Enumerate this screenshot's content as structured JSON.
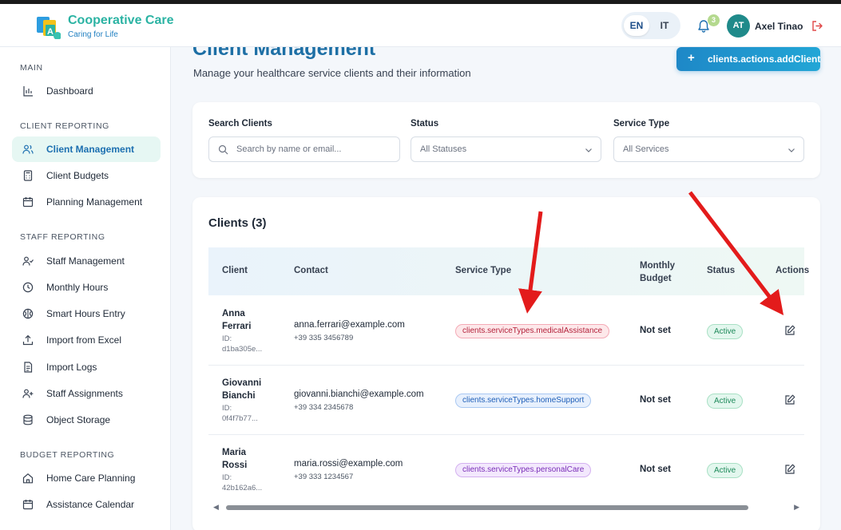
{
  "app": {
    "title": "Cooperative Care",
    "subtitle": "Caring for Life"
  },
  "header": {
    "lang_en": "EN",
    "lang_it": "IT",
    "notification_count": "3",
    "avatar_initials": "AT",
    "user_name": "Axel Tinao"
  },
  "sidebar": {
    "sections": [
      {
        "label": "MAIN",
        "items": [
          {
            "label": "Dashboard",
            "icon": "bar-chart-icon"
          }
        ]
      },
      {
        "label": "CLIENT REPORTING",
        "items": [
          {
            "label": "Client Management",
            "icon": "users-icon",
            "active": true
          },
          {
            "label": "Client Budgets",
            "icon": "calculator-icon"
          },
          {
            "label": "Planning Management",
            "icon": "calendar-icon"
          }
        ]
      },
      {
        "label": "STAFF REPORTING",
        "items": [
          {
            "label": "Staff Management",
            "icon": "user-check-icon"
          },
          {
            "label": "Monthly Hours",
            "icon": "clock-icon"
          },
          {
            "label": "Smart Hours Entry",
            "icon": "brain-icon"
          },
          {
            "label": "Import from Excel",
            "icon": "upload-icon"
          },
          {
            "label": "Import Logs",
            "icon": "file-text-icon"
          },
          {
            "label": "Staff Assignments",
            "icon": "user-plus-icon"
          },
          {
            "label": "Object Storage",
            "icon": "database-icon"
          }
        ]
      },
      {
        "label": "BUDGET REPORTING",
        "items": [
          {
            "label": "Home Care Planning",
            "icon": "home-icon"
          },
          {
            "label": "Assistance Calendar",
            "icon": "calendar-icon"
          }
        ]
      }
    ]
  },
  "main": {
    "page_title": "Client Management",
    "page_subtitle": "Manage your healthcare service clients and their information",
    "add_button": "clients.actions.addClient",
    "filters": {
      "search_label": "Search Clients",
      "search_placeholder": "Search by name or email...",
      "status_label": "Status",
      "status_value": "All Statuses",
      "service_label": "Service Type",
      "service_value": "All Services"
    },
    "table": {
      "title": "Clients (3)",
      "columns": [
        "Client",
        "Contact",
        "Service Type",
        "Monthly Budget",
        "Status",
        "Actions"
      ],
      "rows": [
        {
          "first": "Anna",
          "last": "Ferrari",
          "id_label": "ID:",
          "id": "d1ba305e...",
          "email": "anna.ferrari@example.com",
          "phone": "+39 335 3456789",
          "service": "clients.serviceTypes.medicalAssistance",
          "budget": "Not set",
          "status": "Active"
        },
        {
          "first": "Giovanni",
          "last": "Bianchi",
          "id_label": "ID:",
          "id": "0f4f7b77...",
          "email": "giovanni.bianchi@example.com",
          "phone": "+39 334 2345678",
          "service": "clients.serviceTypes.homeSupport",
          "budget": "Not set",
          "status": "Active"
        },
        {
          "first": "Maria",
          "last": "Rossi",
          "id_label": "ID:",
          "id": "42b162a6...",
          "email": "maria.rossi@example.com",
          "phone": "+39 333 1234567",
          "service": "clients.serviceTypes.personalCare",
          "budget": "Not set",
          "status": "Active"
        }
      ]
    }
  },
  "colors": {
    "brand_teal": "#2bb3a3",
    "brand_blue": "#1f7fc1",
    "active_bg": "#e6f7f3",
    "annotation_red": "#e31b1b"
  }
}
